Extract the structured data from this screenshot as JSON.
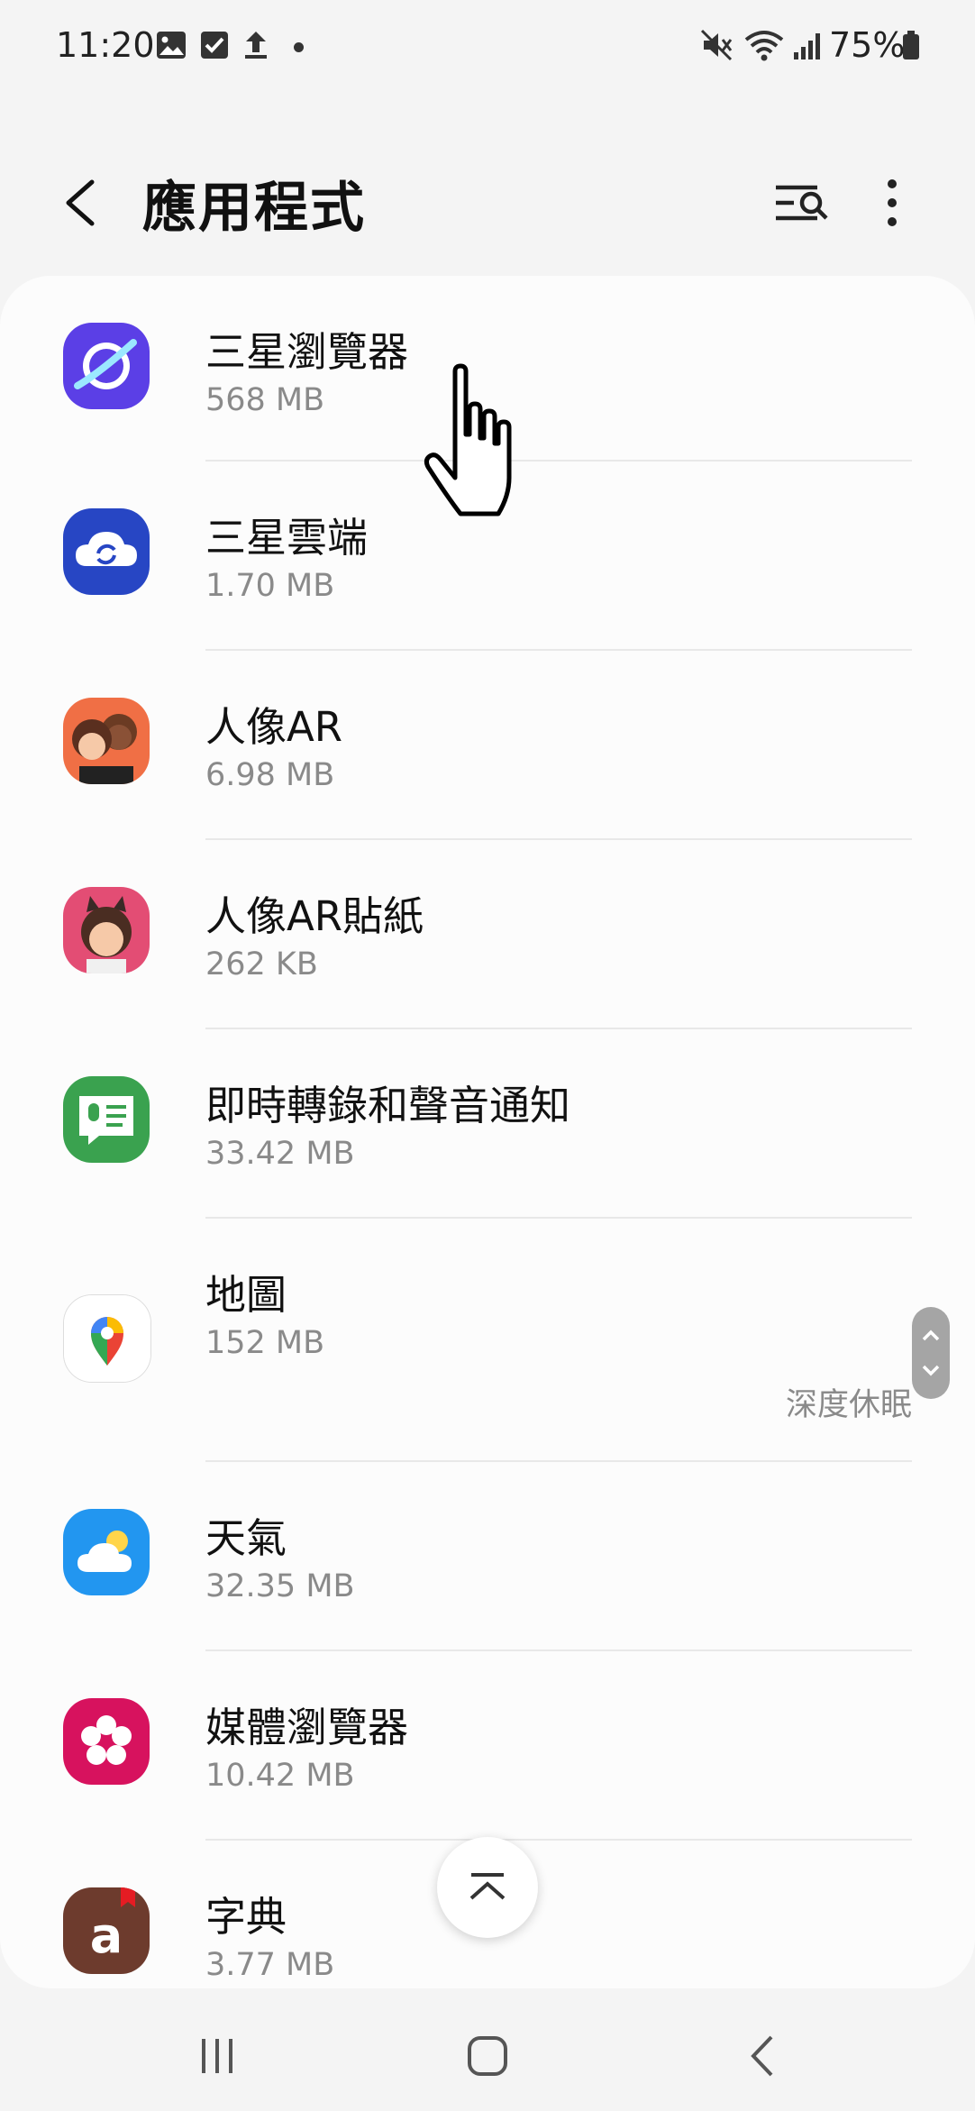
{
  "status_bar": {
    "time": "11:20",
    "left_icons": [
      "gallery-icon",
      "checkbox-icon",
      "upload-icon",
      "notification-dot"
    ],
    "right_icons": [
      "mute-icon",
      "wifi-icon",
      "signal-icon",
      "battery-icon"
    ],
    "battery": "75%"
  },
  "header": {
    "title": "應用程式",
    "icons": [
      "back-icon",
      "search-filter-icon",
      "more-options-icon"
    ]
  },
  "apps": [
    {
      "name": "三星瀏覽器",
      "size": "568 MB",
      "icon": "samsung-internet-icon",
      "color": "#6a4cf0"
    },
    {
      "name": "三星雲端",
      "size": "1.70 MB",
      "icon": "samsung-cloud-icon",
      "color": "#2746c4"
    },
    {
      "name": "人像AR",
      "size": "6.98 MB",
      "icon": "ar-emoji-icon",
      "color": "#f06f45"
    },
    {
      "name": "人像AR貼紙",
      "size": "262 KB",
      "icon": "ar-sticker-icon",
      "color": "#e34d74"
    },
    {
      "name": "即時轉錄和聲音通知",
      "size": "33.42 MB",
      "icon": "live-transcribe-icon",
      "color": "#3aa24f"
    },
    {
      "name": "地圖",
      "size": "152 MB",
      "status": "深度休眠",
      "icon": "maps-icon",
      "color": "#ffffff"
    },
    {
      "name": "天氣",
      "size": "32.35 MB",
      "icon": "weather-icon",
      "color": "#2296f0"
    },
    {
      "name": "媒體瀏覽器",
      "size": "10.42 MB",
      "icon": "media-browser-icon",
      "color": "#d7125e"
    },
    {
      "name": "字典",
      "size": "3.77 MB",
      "icon": "dictionary-icon",
      "color": "#6d3b2d"
    }
  ],
  "controls": {
    "fast_scroll": "scroll-up-down",
    "scroll_top": "scroll-to-top",
    "nav_bar": [
      "recents-icon",
      "home-icon",
      "back-nav-icon"
    ]
  }
}
